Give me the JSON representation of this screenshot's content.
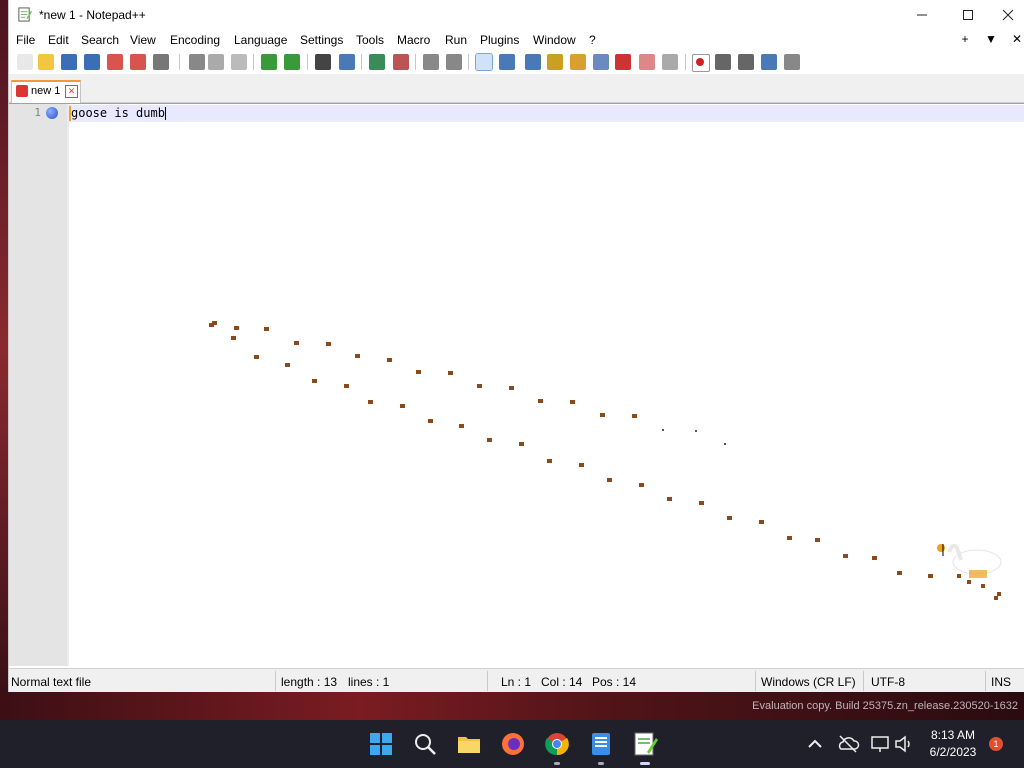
{
  "window": {
    "title": "*new 1 - Notepad++",
    "min_icon": "minimize-icon",
    "max_icon": "maximize-icon",
    "close_icon": "close-icon"
  },
  "menu": {
    "items": [
      "File",
      "Edit",
      "Search",
      "View",
      "Encoding",
      "Language",
      "Settings",
      "Tools",
      "Macro",
      "Run",
      "Plugins",
      "Window",
      "?"
    ],
    "right": [
      "+",
      "▼",
      "✕"
    ]
  },
  "toolbar": {
    "icons": [
      "new-file-icon",
      "open-file-icon",
      "save-icon",
      "save-all-icon",
      "close-icon",
      "close-all-icon",
      "print-icon",
      "cut-icon",
      "copy-icon",
      "paste-icon",
      "undo-icon",
      "redo-icon",
      "find-icon",
      "replace-icon",
      "zoom-in-icon",
      "zoom-out-icon",
      "sync-vertical-icon",
      "sync-horizontal-icon",
      "word-wrap-icon",
      "show-all-chars-icon",
      "indent-guide-icon",
      "udl-icon",
      "doc-map-icon",
      "doc-list-icon",
      "function-list-icon",
      "folder-workspace-icon",
      "monitoring-icon",
      "record-macro-icon",
      "stop-record-icon",
      "playback-icon",
      "run-macro-multiple-icon",
      "save-macro-icon"
    ]
  },
  "tab": {
    "label": "new 1"
  },
  "editor": {
    "line_number": "1",
    "line_text": "goose is dumb"
  },
  "status": {
    "file_type": "Normal text file",
    "length": "length : 13",
    "lines": "lines : 1",
    "ln": "Ln : 1",
    "col": "Col : 14",
    "pos": "Pos : 14",
    "eol": "Windows (CR LF)",
    "encoding": "UTF-8",
    "mode": "INS"
  },
  "desktop": {
    "watermark": "Evaluation copy. Build 25375.zn_release.230520-1632"
  },
  "taskbar": {
    "icons": [
      "start-icon",
      "search-icon",
      "file-explorer-icon",
      "firefox-icon",
      "chrome-icon",
      "notepad-icon",
      "notepadpp-icon"
    ],
    "tray_icons": [
      "chevron-up-icon",
      "onedrive-icon",
      "network-icon",
      "volume-icon"
    ],
    "time": "8:13 AM",
    "date": "6/2/2023",
    "notification_count": "1"
  },
  "colors": {
    "accent": "#f29a3a",
    "current_line": "#e8e8ff",
    "footprint": "#8b4a1c"
  }
}
